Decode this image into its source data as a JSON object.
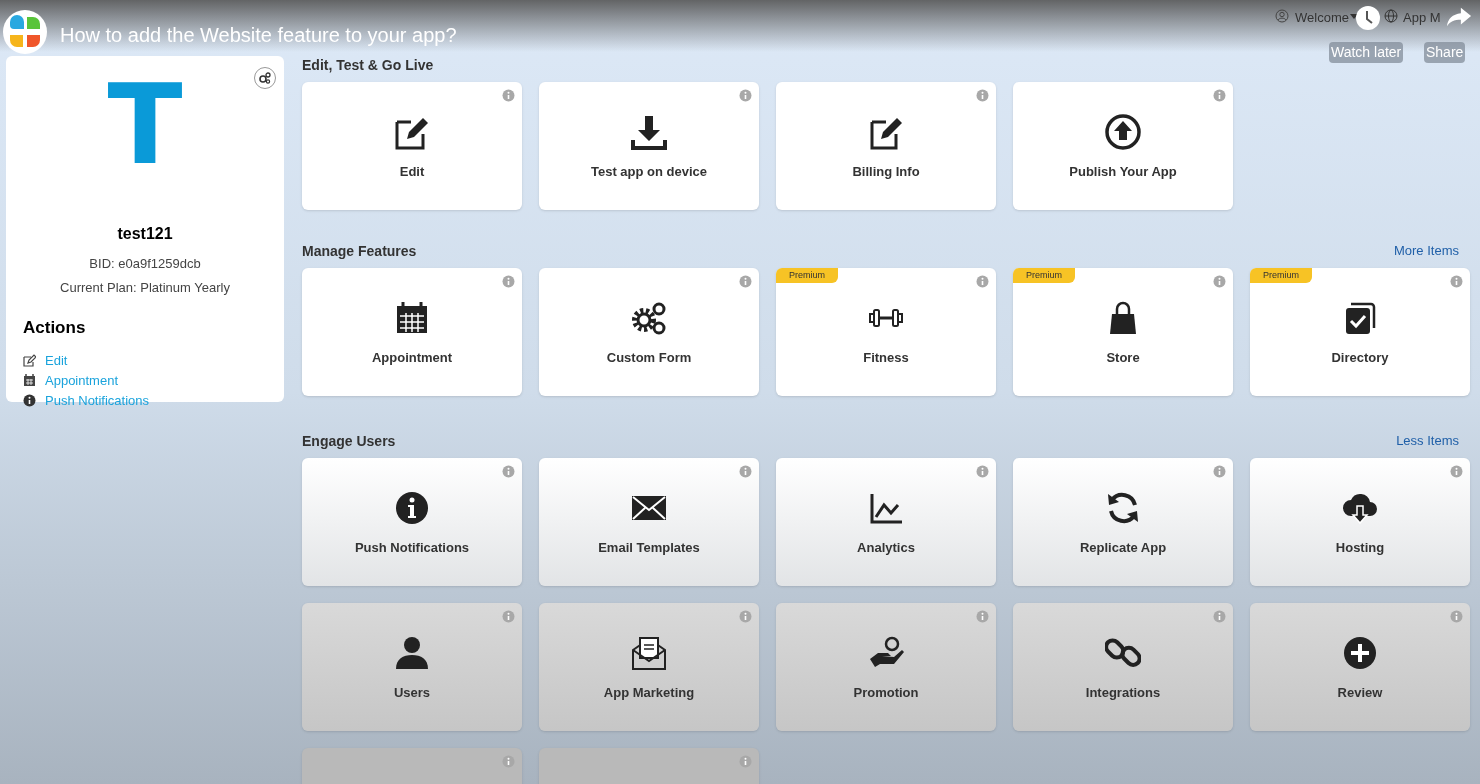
{
  "video": {
    "title": "How to add the Website feature to your app?",
    "watch_later": "Watch later",
    "share": "Share"
  },
  "top_menu": {
    "user": "Welcome",
    "site": "App M"
  },
  "profile": {
    "initial": "T",
    "name": "test121",
    "bid": "BID: e0a9f1259dcb",
    "plan": "Current Plan: Platinum Yearly",
    "actions_title": "Actions",
    "actions": [
      {
        "label": "Edit"
      },
      {
        "label": "Appointment"
      },
      {
        "label": "Push Notifications"
      }
    ]
  },
  "sections": [
    {
      "title": "Edit, Test & Go Live",
      "rows": [
        [
          {
            "label": "Edit",
            "premium": false
          },
          {
            "label": "Test app on device",
            "premium": false
          },
          {
            "label": "Billing Info",
            "premium": false
          },
          {
            "label": "Publish Your App",
            "premium": false
          }
        ]
      ]
    },
    {
      "title": "Manage Features",
      "link": "More Items",
      "rows": [
        [
          {
            "label": "Appointment",
            "premium": false
          },
          {
            "label": "Custom Form",
            "premium": false
          },
          {
            "label": "Fitness",
            "premium": true,
            "badge": "Premium"
          },
          {
            "label": "Store",
            "premium": true,
            "badge": "Premium"
          },
          {
            "label": "Directory",
            "premium": true,
            "badge": "Premium"
          }
        ]
      ]
    },
    {
      "title": "Engage Users",
      "link": "Less Items",
      "rows": [
        [
          {
            "label": "Push Notifications",
            "premium": false
          },
          {
            "label": "Email Templates",
            "premium": false
          },
          {
            "label": "Analytics",
            "premium": false
          },
          {
            "label": "Replicate App",
            "premium": false
          },
          {
            "label": "Hosting",
            "premium": false
          }
        ],
        [
          {
            "label": "Users",
            "premium": false
          },
          {
            "label": "App Marketing",
            "premium": false
          },
          {
            "label": "Promotion",
            "premium": false
          },
          {
            "label": "Integrations",
            "premium": false
          },
          {
            "label": "Review",
            "premium": false
          }
        ],
        [
          {
            "premium": false
          },
          {
            "premium": false
          }
        ]
      ]
    }
  ]
}
